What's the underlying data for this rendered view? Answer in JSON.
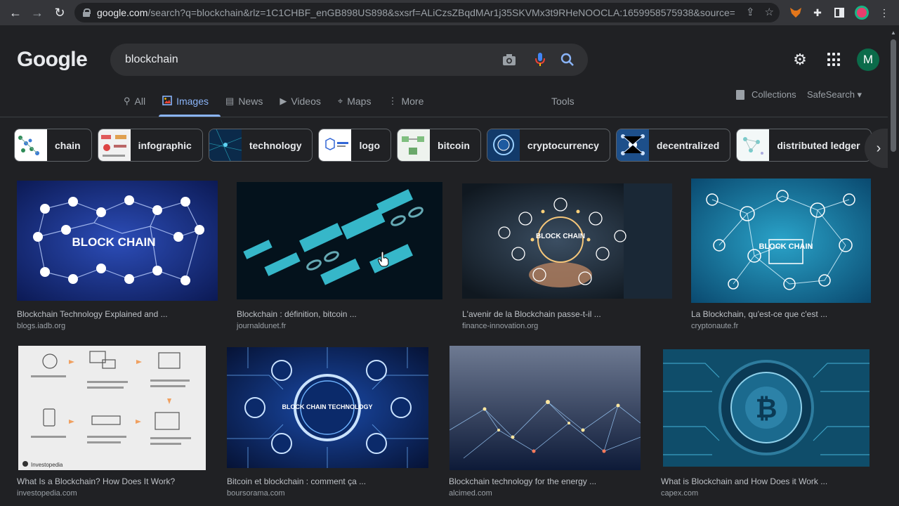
{
  "browser": {
    "url_host": "google.com",
    "url_path": "/search?q=blockchain&rlz=1C1CHBF_enGB898US898&sxsrf=ALiCzsZBqdMAr1j35SKVMx3t9RHeNOOCLA:1659958575938&source=lnm..."
  },
  "google": {
    "logo": "Google",
    "query": "blockchain",
    "avatar_letter": "M"
  },
  "tabs": [
    {
      "label": "All",
      "icon": "search-icon"
    },
    {
      "label": "Images",
      "icon": "image-icon",
      "active": true
    },
    {
      "label": "News",
      "icon": "news-icon"
    },
    {
      "label": "Videos",
      "icon": "video-icon"
    },
    {
      "label": "Maps",
      "icon": "map-pin-icon"
    },
    {
      "label": "More",
      "icon": "more-vert-icon"
    }
  ],
  "toolbar": {
    "tools_label": "Tools",
    "collections_label": "Collections",
    "safesearch_label": "SafeSearch ▾"
  },
  "chips": [
    {
      "label": "chain",
      "thumb_color": "#ffffff"
    },
    {
      "label": "infographic",
      "thumb_color": "#f1f1f1"
    },
    {
      "label": "technology",
      "thumb_color": "#0b2a4a"
    },
    {
      "label": "logo",
      "thumb_color": "#ffffff"
    },
    {
      "label": "bitcoin",
      "thumb_color": "#eef3ee"
    },
    {
      "label": "cryptocurrency",
      "thumb_color": "#123a6a"
    },
    {
      "label": "decentralized",
      "thumb_color": "#1d4f8a"
    },
    {
      "label": "distributed ledger",
      "thumb_color": "#f3f8f8"
    }
  ],
  "results": [
    {
      "title": "Blockchain Technology Explained and ...",
      "site": "blogs.iadb.org",
      "caption": "BLOCK CHAIN"
    },
    {
      "title": "Blockchain : définition, bitcoin ...",
      "site": "journaldunet.fr",
      "caption": ""
    },
    {
      "title": "L'avenir de la Blockchain passe-t-il ...",
      "site": "finance-innovation.org",
      "caption": "BLOCK CHAIN"
    },
    {
      "title": "La Blockchain, qu'est-ce que c'est ...",
      "site": "cryptonaute.fr",
      "caption": "BLOCK CHAIN"
    },
    {
      "title": "What Is a Blockchain? How Does It Work?",
      "site": "investopedia.com",
      "caption": "Investopedia"
    },
    {
      "title": "Bitcoin et blockchain : comment ça ...",
      "site": "boursorama.com",
      "caption": "BLOCK CHAIN TECHNOLOGY"
    },
    {
      "title": "Blockchain technology for the energy ...",
      "site": "alcimed.com",
      "caption": ""
    },
    {
      "title": "What is Blockchain and How Does it Work ...",
      "site": "capex.com",
      "caption": ""
    }
  ],
  "colors": {
    "accent": "#8ab4f8",
    "background": "#202124",
    "avatar": "#0b6b4a"
  }
}
